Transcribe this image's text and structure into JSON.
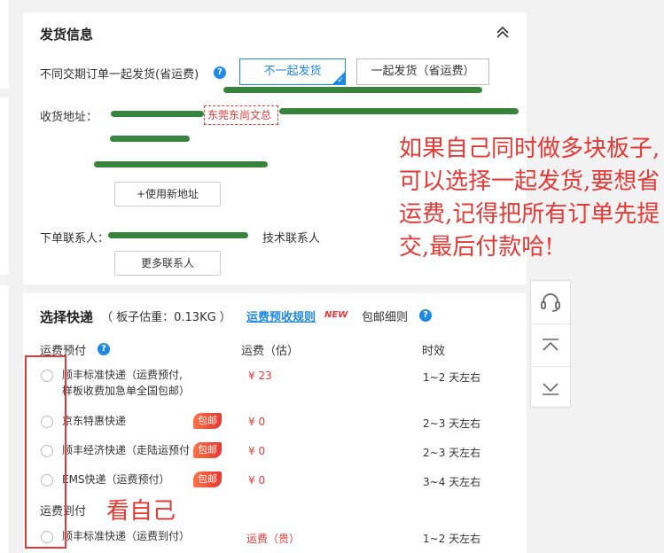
{
  "shipping": {
    "title": "发货信息",
    "same_ship_label": "不同交期订单一起发货(省运费)",
    "opt_separate": "不一起发货",
    "opt_together": "一起发货（省运费）",
    "address_label": "收货地址：",
    "address_tag": "东莞东尚文总",
    "use_new_address": "+使用新地址",
    "order_contact_label": "下单联系人：",
    "tech_contact_label": "技术联系人",
    "more_contacts": "更多联系人"
  },
  "courier": {
    "title": "选择快递",
    "weight_note": "（ 板子估重：0.13KG ）",
    "rules_link": "运费预收规则",
    "new_badge": "NEW",
    "free_shipping_rules": "包邮细则",
    "group_prepaid": "运费预付",
    "col_fee": "运费（估）",
    "col_time": "时效",
    "rows": [
      {
        "name": "顺丰标准快递（运费预付,\n样板收费加急单全国包邮）",
        "price": "¥ 23",
        "time": "1~2 天左右",
        "badge": ""
      },
      {
        "name": "京东特惠快递",
        "price": "¥ 0",
        "time": "2~3 天左右",
        "badge": "包邮"
      },
      {
        "name": "顺丰经济快递（走陆运预付",
        "price": "¥ 0",
        "time": "2~3 天左右",
        "badge": "包邮"
      },
      {
        "name": "EMS快递（运费预付）",
        "price": "¥ 0",
        "time": "3~4 天左右",
        "badge": "包邮"
      }
    ],
    "group_collect": "运费到付",
    "collect_rows": [
      {
        "name": "顺丰标准快递（运费到付）",
        "price": "运费（贵）",
        "time": "1~2 天左右"
      }
    ]
  },
  "annotations": {
    "note_main": "如果自己同时做多块板子,可以选择一起发货,要想省运费,记得把所有订单先提交,最后付款哈!",
    "note_side": "看自己"
  },
  "sidebar_tools": {
    "icons": [
      "headset-icon",
      "back-to-top-icon",
      "scroll-to-bottom-icon"
    ]
  },
  "colors": {
    "accent_blue": "#1e88e5",
    "price_red": "#e53935",
    "annotation_red": "#e53935",
    "redaction_green": "#2e7d32"
  }
}
